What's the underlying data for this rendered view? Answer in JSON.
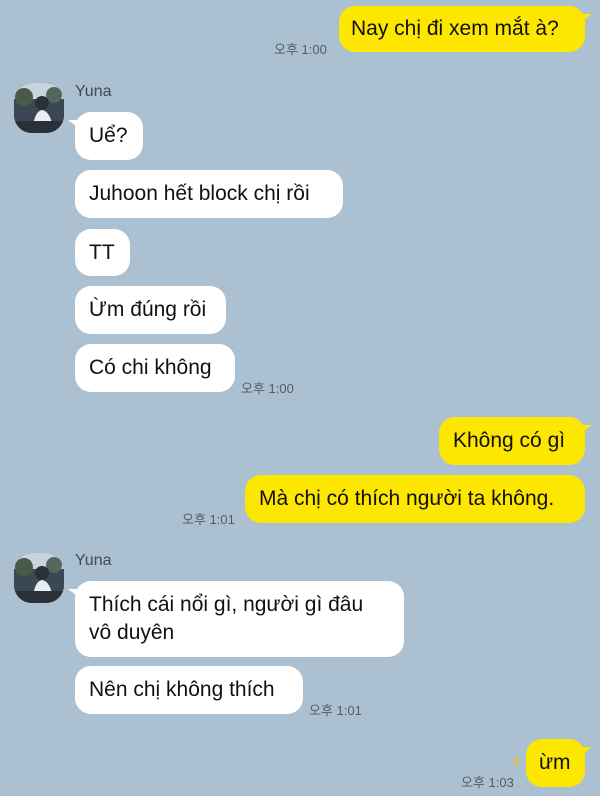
{
  "chat": {
    "contact_name": "Yuna",
    "avatar_icon": "profile-photo",
    "colors": {
      "background": "#abc1d1",
      "my_bubble": "#fde600",
      "their_bubble": "#ffffff"
    },
    "messages": [
      {
        "sender": "me",
        "text": "Nay chị đi xem mắt à?",
        "time": "오후 1:00"
      },
      {
        "sender": "Yuna",
        "text": "Uể?"
      },
      {
        "sender": "Yuna",
        "text": "Juhoon hết block chị rồi"
      },
      {
        "sender": "Yuna",
        "text": "TT"
      },
      {
        "sender": "Yuna",
        "text": "Ừm đúng rồi"
      },
      {
        "sender": "Yuna",
        "text": "Có chi không",
        "time": "오후 1:00"
      },
      {
        "sender": "me",
        "text": "Không có gì"
      },
      {
        "sender": "me",
        "text": "Mà chị có thích người ta không.",
        "time": "오후 1:01"
      },
      {
        "sender": "Yuna",
        "text": "Thích cái nổi gì, người gì đâu",
        "text_line2": "vô duyên"
      },
      {
        "sender": "Yuna",
        "text": "Nên chị không thích",
        "time": "오후 1:01"
      },
      {
        "sender": "me",
        "text": "ừm",
        "time": "오후 1:03",
        "unread": "1"
      }
    ]
  }
}
